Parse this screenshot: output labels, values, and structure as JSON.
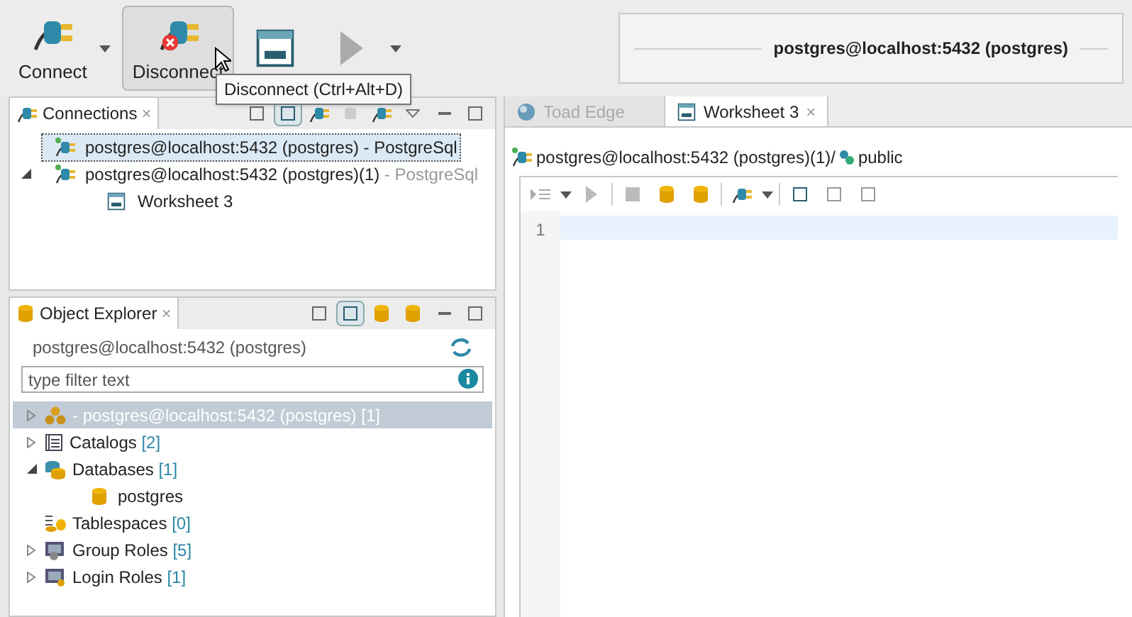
{
  "toolbar": {
    "buttons": [
      {
        "kind": "connect",
        "label": "Connect",
        "hovered": false,
        "dropdown": true
      },
      {
        "kind": "disconnect",
        "label": "Disconnect",
        "hovered": true,
        "dropdown": false
      },
      {
        "kind": "worksheet",
        "hovered": false,
        "dropdown": false
      },
      {
        "kind": "execute",
        "hovered": false,
        "dropdown": true
      }
    ],
    "tooltip": "Disconnect (Ctrl+Alt+D)"
  },
  "connection_banner": "postgres@localhost:5432 (postgres)",
  "connections_panel": {
    "title": "Connections",
    "close": "×",
    "items": [
      {
        "label": "postgres@localhost:5432 (postgres) - PostgreSql",
        "selected": true
      },
      {
        "label": "postgres@localhost:5432 (postgres)(1)",
        "suffix": " - PostgreSql",
        "selected": false,
        "expanded": true,
        "children": [
          {
            "label": "Worksheet 3"
          }
        ]
      }
    ]
  },
  "object_explorer": {
    "title": "Object Explorer",
    "close": "×",
    "connection": "postgres@localhost:5432 (postgres)",
    "filter": {
      "placeholder": "type filter text"
    },
    "tree": [
      {
        "kind": "server",
        "label": "- postgres@localhost:5432 (postgres)",
        "count": "[1]",
        "selected": true,
        "expanded": false
      },
      {
        "kind": "catalogs",
        "label": "Catalogs",
        "count": "[2]",
        "selected": false,
        "expanded": false
      },
      {
        "kind": "databases",
        "label": "Databases",
        "count": "[1]",
        "selected": false,
        "expanded": true,
        "children": [
          {
            "kind": "database",
            "label": "postgres"
          }
        ]
      },
      {
        "kind": "tablespaces",
        "label": "Tablespaces",
        "count": "[0]",
        "selected": false
      },
      {
        "kind": "group_roles",
        "label": "Group Roles",
        "count": "[5]",
        "selected": false,
        "expanded": false
      },
      {
        "kind": "login_roles",
        "label": "Login Roles",
        "count": "[1]",
        "selected": false,
        "expanded": false
      }
    ]
  },
  "editor": {
    "tabs": [
      {
        "label": "Toad Edge",
        "selected": false
      },
      {
        "label": "Worksheet 3",
        "selected": true,
        "close": "×"
      }
    ],
    "breadcrumb": {
      "connection": "postgres@localhost:5432 (postgres)(1)/",
      "schema": "public"
    },
    "line_numbers": [
      "1"
    ]
  }
}
